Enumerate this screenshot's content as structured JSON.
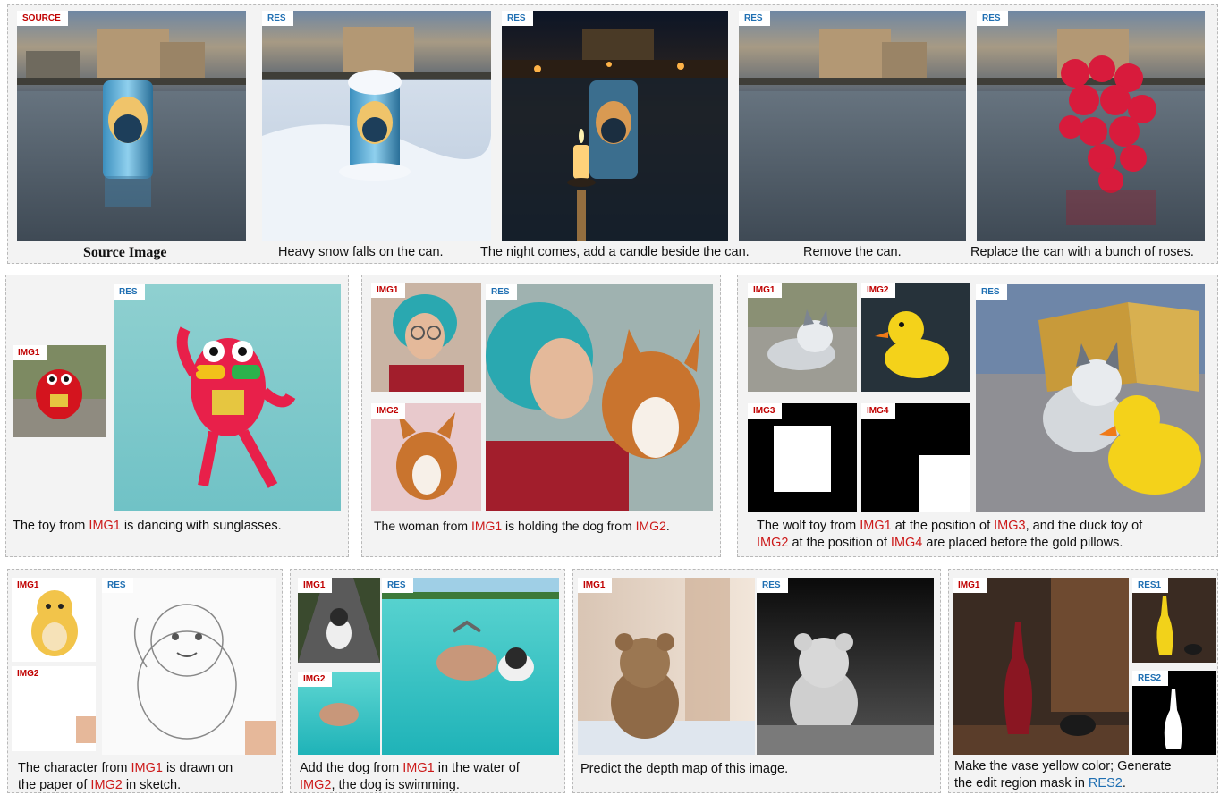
{
  "row1": {
    "tags": {
      "source": "SOURCE",
      "res": "RES"
    },
    "captions": [
      "Source Image",
      "Heavy snow falls on the can.",
      "The night comes, add a candle beside the can.",
      "Remove the can.",
      "Replace the can with a bunch of roses."
    ]
  },
  "p1": {
    "tag_img1": "IMG1",
    "tag_res": "RES",
    "cap_a": "The toy from ",
    "cap_ref": "IMG1",
    "cap_b": " is dancing with sunglasses."
  },
  "p2": {
    "tag_img1": "IMG1",
    "tag_img2": "IMG2",
    "tag_res": "RES",
    "cap_a": "The woman from ",
    "cap_ref1": "IMG1",
    "cap_b": " is holding the dog from ",
    "cap_ref2": "IMG2",
    "cap_c": "."
  },
  "p3": {
    "tag_img1": "IMG1",
    "tag_img2": "IMG2",
    "tag_img3": "IMG3",
    "tag_img4": "IMG4",
    "tag_res": "RES",
    "l1_a": "The wolf toy from ",
    "l1_ref1": "IMG1",
    "l1_b": " at the position of ",
    "l1_ref2": "IMG3",
    "l1_c": ", and the duck toy of",
    "l2_ref1": "IMG2",
    "l2_a": " at the position of ",
    "l2_ref2": "IMG4",
    "l2_b": " are placed before the gold pillows."
  },
  "p4": {
    "tag_img1": "IMG1",
    "tag_img2": "IMG2",
    "tag_res": "RES",
    "l1_a": "The character from ",
    "l1_ref": "IMG1",
    "l1_b": " is drawn on",
    "l2_a": "the paper of ",
    "l2_ref": "IMG2",
    "l2_b": " in sketch."
  },
  "p5": {
    "tag_img1": "IMG1",
    "tag_img2": "IMG2",
    "tag_res": "RES",
    "l1_a": "Add the dog from ",
    "l1_ref": "IMG1",
    "l1_b": " in the water of",
    "l2_ref": "IMG2",
    "l2_b": ", the dog is swimming."
  },
  "p6": {
    "tag_img1": "IMG1",
    "tag_res": "RES",
    "caption": "Predict the depth map of this image."
  },
  "p7": {
    "tag_img1": "IMG1",
    "tag_res1": "RES1",
    "tag_res2": "RES2",
    "l1": "Make the vase yellow color; Generate",
    "l2_a": "the edit region mask in ",
    "l2_ref": "RES2",
    "l2_b": "."
  }
}
